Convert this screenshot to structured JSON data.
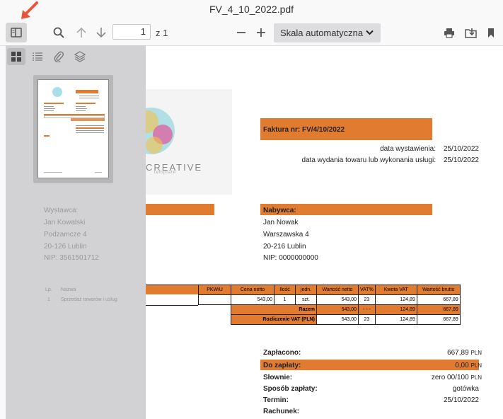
{
  "window": {
    "title": "FV_4_10_2022.pdf"
  },
  "toolbar": {
    "page_number": "1",
    "page_total": "z 1",
    "scale": "Skala automatyczna"
  },
  "logo": {
    "text": "CREATIVE",
    "subtext": "template"
  },
  "invoice": {
    "title": "Faktura nr: FV/4/10/2022",
    "issue_label": "data wystawienia:",
    "issue_date": "25/10/2022",
    "delivery_label": "data wydania towaru lub wykonania usługi:",
    "delivery_date": "25/10/2022"
  },
  "seller": {
    "heading": "Wystawca:",
    "name": "Jan Kowalski",
    "street": "Podzamcze 4",
    "city": "20-126 Lublin",
    "nip": "NIP: 3561501712"
  },
  "buyer": {
    "heading": "Nabywca:",
    "name": "Jan Nowak",
    "street": "Warszawska 4",
    "city": "20-216 Lublin",
    "nip": "NIP: 0000000000"
  },
  "items_table": {
    "headers": [
      "Lp.",
      "Nazwa",
      "PKWiU",
      "Cena netto",
      "Ilość",
      "jedn.",
      "Wartość netto",
      "VAT%",
      "Kwota VAT",
      "Wartość brutto"
    ],
    "rows": [
      [
        "1",
        "Sprzedaż towarów i usług",
        "",
        "543,00",
        "1",
        "szt.",
        "543,00",
        "23",
        "124,89",
        "667,89"
      ]
    ],
    "total_label": "Razem",
    "total": [
      "543,00",
      "- - -",
      "124,89",
      "667,89"
    ],
    "vat_label": "Rozliczenie VAT (PLN)",
    "vat": [
      "543,00",
      "23",
      "124,89",
      "667,89"
    ]
  },
  "summary": {
    "paid_label": "Zapłacono:",
    "paid_value": "667,89",
    "paid_currency": "PLN",
    "due_label": "Do zapłaty:",
    "due_value": "0,00",
    "due_currency": "PLN",
    "words_label": "Słownie:",
    "words_value": "zero 00/100",
    "words_currency": "PLN",
    "method_label": "Sposób zapłaty:",
    "method_value": "gotówka",
    "term_label": "Termin:",
    "term_value": "25/10/2022",
    "account_label": "Rachunek:"
  },
  "colors": {
    "accent": "#e07b2f",
    "annotation_arrow": "#e8553b"
  }
}
